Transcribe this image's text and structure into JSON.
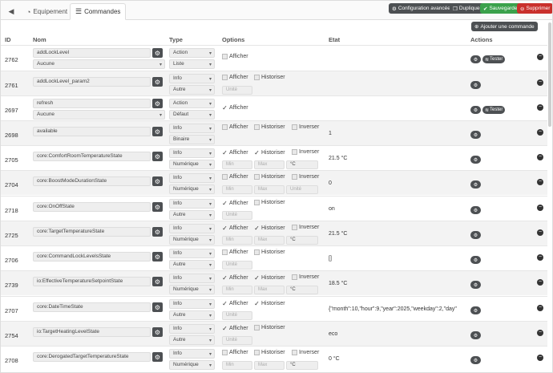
{
  "tabs": {
    "back_icon": "arrow-left-circle",
    "equipment": "Equipement",
    "commands": "Commandes"
  },
  "toolbar": {
    "config": "Configuration avancée",
    "duplicate": "Dupliquer",
    "save": "Sauvegarder",
    "delete": "Supprimer",
    "add": "Ajouter une commande"
  },
  "headers": {
    "id": "ID",
    "name": "Nom",
    "type": "Type",
    "options": "Options",
    "state": "Etat",
    "actions": "Actions"
  },
  "labels": {
    "show": "Afficher",
    "history": "Historiser",
    "invert": "Inverser",
    "unit": "Unité",
    "min": "Min",
    "max": "Max",
    "test": "Tester"
  },
  "rows": [
    {
      "id": "2762",
      "name": "addLockLevel",
      "sub": "Aucune",
      "type": "Action",
      "subtype": "Liste",
      "show": false,
      "history": null,
      "invert": null,
      "minmax": false,
      "unit": "",
      "state": "",
      "tester": true
    },
    {
      "id": "2761",
      "name": "addLockLevel_param2",
      "sub": "",
      "type": "Info",
      "subtype": "Autre",
      "show": false,
      "history": false,
      "invert": null,
      "minmax": false,
      "unit": "Unité",
      "state": "",
      "tester": false
    },
    {
      "id": "2697",
      "name": "refresh",
      "sub": "Aucune",
      "type": "Action",
      "subtype": "Défaut",
      "show": true,
      "history": null,
      "invert": null,
      "minmax": false,
      "unit": "",
      "state": "",
      "tester": true
    },
    {
      "id": "2698",
      "name": "available",
      "sub": "",
      "type": "Info",
      "subtype": "Binaire",
      "show": false,
      "history": false,
      "invert": false,
      "minmax": false,
      "unit": "",
      "state": "1",
      "tester": false
    },
    {
      "id": "2705",
      "name": "core:ComfortRoomTemperatureState",
      "sub": "",
      "type": "Info",
      "subtype": "Numérique",
      "show": true,
      "history": true,
      "invert": false,
      "minmax": true,
      "unit": "°C",
      "state": "21.5 °C",
      "tester": false
    },
    {
      "id": "2704",
      "name": "core:BoostModeDurationState",
      "sub": "",
      "type": "Info",
      "subtype": "Numérique",
      "show": false,
      "history": false,
      "invert": false,
      "minmax": true,
      "unit": "Unité",
      "state": "0",
      "tester": false
    },
    {
      "id": "2718",
      "name": "core:OnOffState",
      "sub": "",
      "type": "Info",
      "subtype": "Autre",
      "show": true,
      "history": false,
      "invert": null,
      "minmax": false,
      "unit": "Unité",
      "state": "on",
      "tester": false
    },
    {
      "id": "2725",
      "name": "core:TargetTemperatureState",
      "sub": "",
      "type": "Info",
      "subtype": "Numérique",
      "show": true,
      "history": true,
      "invert": false,
      "minmax": true,
      "unit": "°C",
      "state": "21.5 °C",
      "tester": false
    },
    {
      "id": "2706",
      "name": "core:CommandLockLevelsState",
      "sub": "",
      "type": "Info",
      "subtype": "Autre",
      "show": false,
      "history": false,
      "invert": null,
      "minmax": false,
      "unit": "Unité",
      "state": "[]",
      "tester": false
    },
    {
      "id": "2739",
      "name": "io:EffectiveTemperatureSetpointState",
      "sub": "",
      "type": "Info",
      "subtype": "Numérique",
      "show": true,
      "history": true,
      "invert": false,
      "minmax": true,
      "unit": "°C",
      "state": "18.5 °C",
      "tester": false
    },
    {
      "id": "2707",
      "name": "core:DateTimeState",
      "sub": "",
      "type": "Info",
      "subtype": "Autre",
      "show": true,
      "history": true,
      "invert": null,
      "minmax": false,
      "unit": "Unité",
      "state": "{\"month\":10,\"hour\":9,\"year\":2025,\"weekday\":2,\"day\"",
      "tester": false
    },
    {
      "id": "2754",
      "name": "io:TargetHeatingLevelState",
      "sub": "",
      "type": "Info",
      "subtype": "Autre",
      "show": true,
      "history": false,
      "invert": null,
      "minmax": false,
      "unit": "Unité",
      "state": "eco",
      "tester": false
    },
    {
      "id": "2708",
      "name": "core:DerogatedTargetTemperatureState",
      "sub": "",
      "type": "Info",
      "subtype": "Numérique",
      "show": false,
      "history": false,
      "invert": false,
      "minmax": true,
      "unit": "°C",
      "state": "0 °C",
      "tester": false
    }
  ],
  "colors": {
    "dark": "#4d5053",
    "save": "#3aa14b",
    "delete": "#c9302c"
  }
}
